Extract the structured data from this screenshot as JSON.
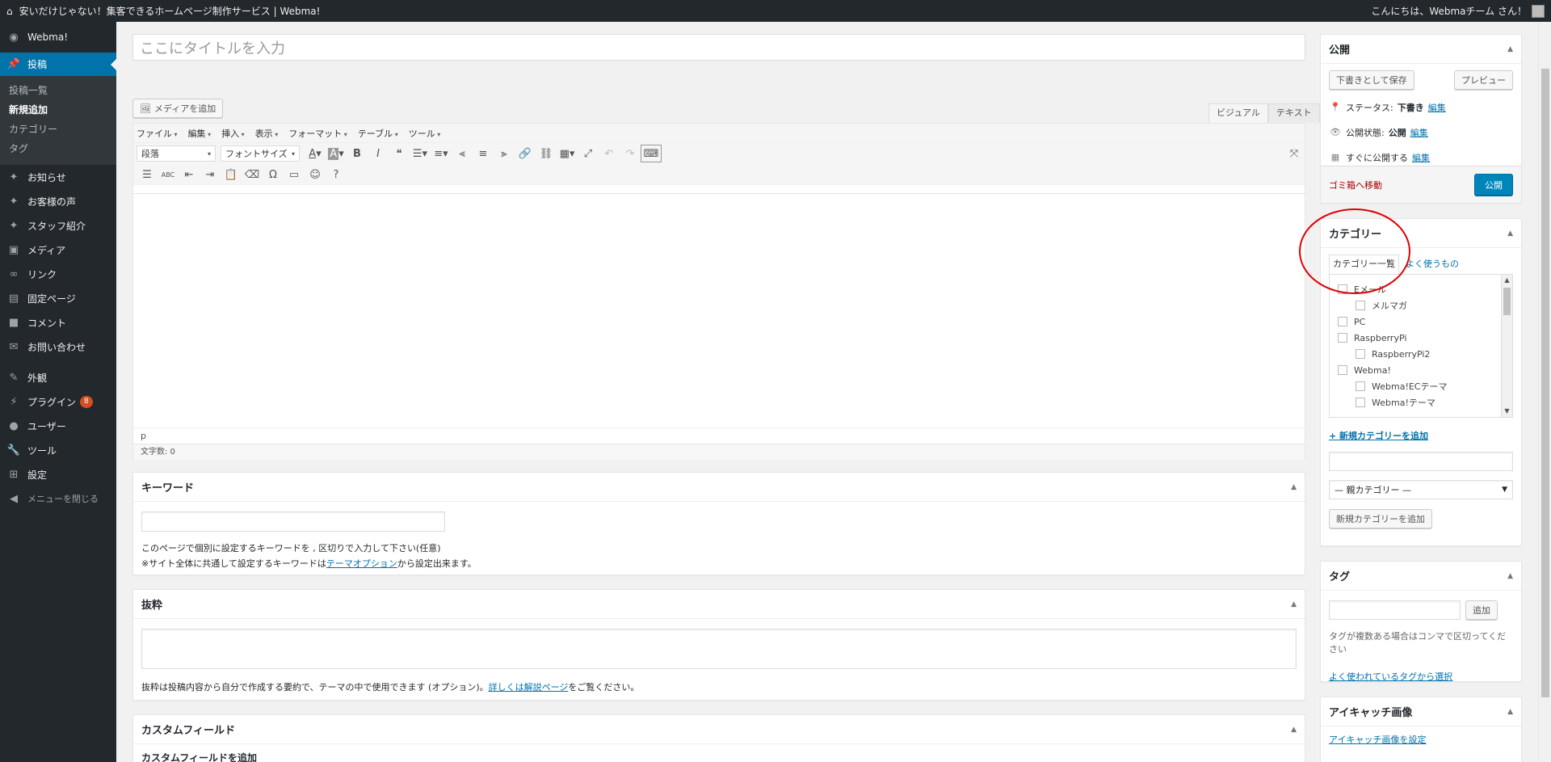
{
  "adminbar": {
    "site_title": "安いだけじゃない！集客できるホームページ制作サービス | Webma!",
    "greeting": "こんにちは、Webmaチーム さん！"
  },
  "sidebar": {
    "dashboard": "Webma!",
    "posts": "投稿",
    "submenu": [
      "投稿一覧",
      "新規追加",
      "カテゴリー",
      "タグ"
    ],
    "items": [
      "お知らせ",
      "お客様の声",
      "スタッフ紹介",
      "メディア",
      "リンク",
      "固定ページ",
      "コメント",
      "お問い合わせ"
    ],
    "items2": [
      "外観",
      "プラグイン",
      "ユーザー",
      "ツール",
      "設定"
    ],
    "plugin_badge": "8",
    "collapse": "メニューを閉じる"
  },
  "editor": {
    "title_placeholder": "ここにタイトルを入力",
    "media_button": "メディアを追加",
    "tab_visual": "ビジュアル",
    "tab_text": "テキスト",
    "menubar": [
      "ファイル",
      "編集",
      "挿入",
      "表示",
      "フォーマット",
      "テーブル",
      "ツール"
    ],
    "format_select": "段落",
    "fontsize_select": "フォントサイズ",
    "path": "p",
    "wordcount": "文字数: 0"
  },
  "keyword_box": {
    "title": "キーワード",
    "desc_line1": "このページで個別に設定するキーワードを , 区切りで入力して下さい(任意)",
    "desc_line2_pre": "※サイト全体に共通して設定するキーワードは",
    "desc_line2_link": "テーマオプション",
    "desc_line2_post": "から設定出来ます。"
  },
  "excerpt_box": {
    "title": "抜粋",
    "desc_pre": "抜粋は投稿内容から自分で作成する要約で、テーマの中で使用できます (オプション)。",
    "desc_link": "詳しくは解説ページ",
    "desc_post": "をご覧ください。"
  },
  "customfield_box": {
    "title": "カスタムフィールド",
    "sub": "カスタムフィールドを追加"
  },
  "publish_box": {
    "title": "公開",
    "save_draft": "下書きとして保存",
    "preview": "プレビュー",
    "status_label": "ステータス:",
    "status_value": "下書き",
    "visibility_label": "公開状態:",
    "visibility_value": "公開",
    "schedule_label": "すぐに公開する",
    "edit": "編集",
    "trash": "ゴミ箱へ移動",
    "publish": "公開"
  },
  "category_box": {
    "title": "カテゴリー",
    "tab_all": "カテゴリー一覧",
    "tab_popular": "よく使うもの",
    "categories": [
      {
        "name": "Eメール",
        "level": 0
      },
      {
        "name": "メルマガ",
        "level": 1
      },
      {
        "name": "PC",
        "level": 0
      },
      {
        "name": "RaspberryPi",
        "level": 0
      },
      {
        "name": "RaspberryPi2",
        "level": 1
      },
      {
        "name": "Webma!",
        "level": 0
      },
      {
        "name": "Webma!ECテーマ",
        "level": 1
      },
      {
        "name": "Webma!テーマ",
        "level": 1
      }
    ],
    "add_link": "+ 新規カテゴリーを追加",
    "parent_select": "— 親カテゴリー —",
    "add_button": "新規カテゴリーを追加"
  },
  "tag_box": {
    "title": "タグ",
    "add_button": "追加",
    "hint": "タグが複数ある場合はコンマで区切ってください",
    "popular_link": "よく使われているタグから選択"
  },
  "thumbnail_box": {
    "title": "アイキャッチ画像",
    "set_link": "アイキャッチ画像を設定"
  },
  "colors": {
    "sidebar_bg": "#23282d",
    "accent": "#0073aa",
    "annotation_circle": "#e00000"
  }
}
